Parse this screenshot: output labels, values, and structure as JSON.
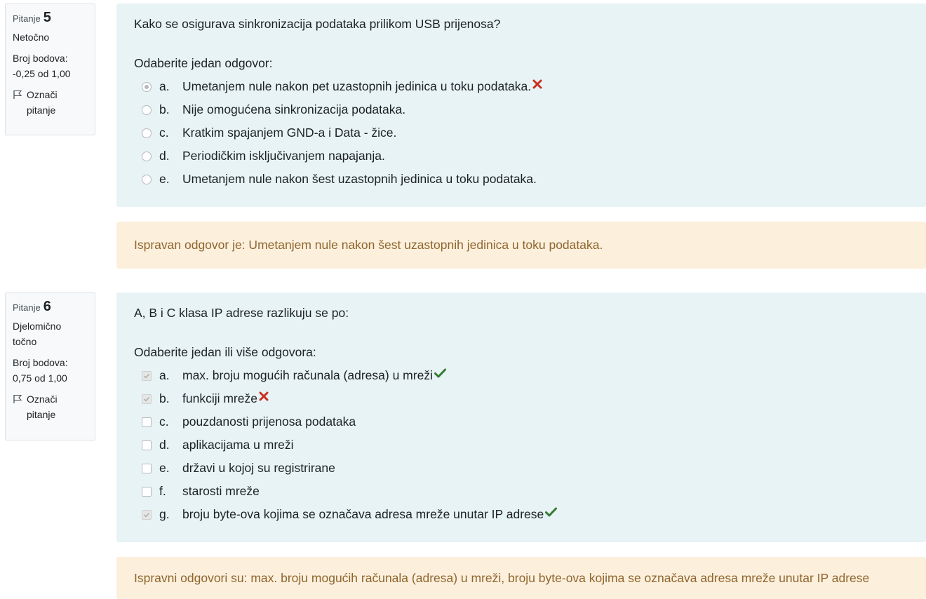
{
  "questions": [
    {
      "label": "Pitanje",
      "number": "5",
      "state": "Netočno",
      "grade_label": "Broj bodova:",
      "grade_value": "-0,25 od 1,00",
      "flag_label": "Označi pitanje",
      "text": "Kako se osigurava sinkronizacija podataka prilikom USB prijenosa?",
      "prompt": "Odaberite jedan odgovor:",
      "input_type": "radio",
      "answers": [
        {
          "letter": "a.",
          "text": "Umetanjem nule nakon pet uzastopnih jedinica u toku podataka.",
          "checked": true,
          "mark": "incorrect"
        },
        {
          "letter": "b.",
          "text": "Nije omogućena sinkronizacija podataka.",
          "checked": false,
          "mark": ""
        },
        {
          "letter": "c.",
          "text": "Kratkim spajanjem GND-a i Data - žice.",
          "checked": false,
          "mark": ""
        },
        {
          "letter": "d.",
          "text": "Periodičkim isključivanjem napajanja.",
          "checked": false,
          "mark": ""
        },
        {
          "letter": "e.",
          "text": "Umetanjem nule nakon šest uzastopnih jedinica u toku podataka.",
          "checked": false,
          "mark": ""
        }
      ],
      "feedback": "Ispravan odgovor je: Umetanjem nule nakon šest uzastopnih jedinica u toku podataka."
    },
    {
      "label": "Pitanje",
      "number": "6",
      "state": "Djelomično točno",
      "grade_label": "Broj bodova:",
      "grade_value": "0,75 od 1,00",
      "flag_label": "Označi pitanje",
      "text": "A, B i C klasa IP adrese razlikuju se po:",
      "prompt": "Odaberite jedan ili više odgovora:",
      "input_type": "checkbox",
      "answers": [
        {
          "letter": "a.",
          "text": "max. broju mogućih računala (adresa) u mreži",
          "checked": true,
          "mark": "correct"
        },
        {
          "letter": "b.",
          "text": "funkciji mreže",
          "checked": true,
          "mark": "incorrect"
        },
        {
          "letter": "c.",
          "text": "pouzdanosti prijenosa podataka",
          "checked": false,
          "mark": ""
        },
        {
          "letter": "d.",
          "text": "aplikacijama u mreži",
          "checked": false,
          "mark": ""
        },
        {
          "letter": "e.",
          "text": "državi u kojoj su registrirane",
          "checked": false,
          "mark": ""
        },
        {
          "letter": "f.",
          "text": "starosti mreže",
          "checked": false,
          "mark": ""
        },
        {
          "letter": "g.",
          "text": "broju byte-ova kojima se označava adresa mreže unutar IP adrese",
          "checked": true,
          "mark": "correct"
        }
      ],
      "feedback": "Ispravni odgovori su: max. broju mogućih računala (adresa) u mreži, broju byte-ova kojima se označava adresa mreže unutar IP adrese"
    }
  ],
  "colors": {
    "info_bg": "#f8f9fa",
    "formulation_bg": "#e7f3f5",
    "feedback_bg": "#fcefdc",
    "feedback_text": "#8e662e",
    "correct": "#357a32",
    "incorrect": "#ca3120"
  }
}
